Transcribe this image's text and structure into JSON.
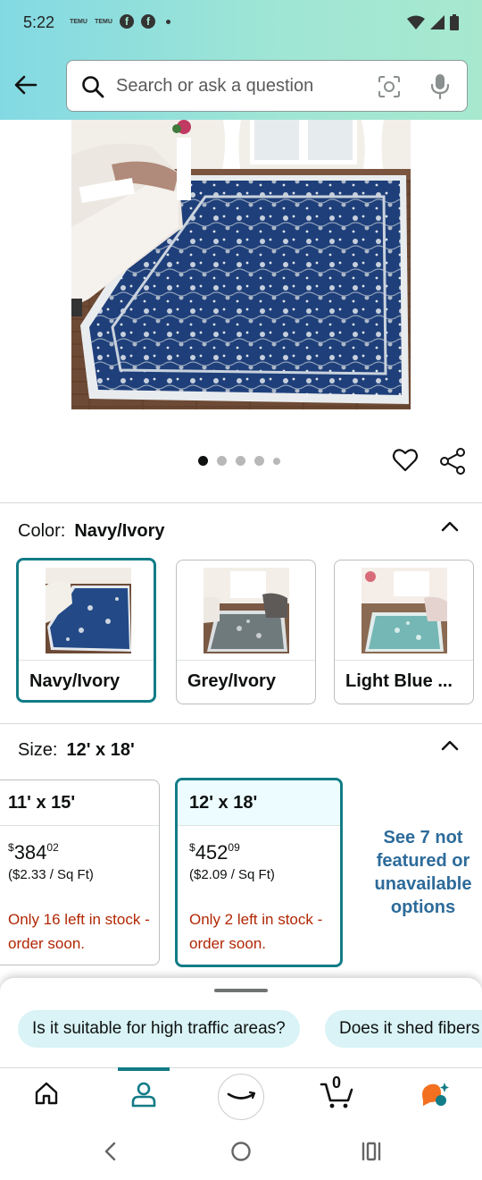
{
  "status_bar": {
    "time": "5:22",
    "badges": [
      "TEMU",
      "TEMU"
    ]
  },
  "search": {
    "placeholder": "Search or ask a question"
  },
  "gallery": {
    "image_count": 5,
    "active_index": 0
  },
  "color_section": {
    "label": "Color:",
    "selected": "Navy/Ivory",
    "options": [
      {
        "label": "Navy/Ivory",
        "selected": true
      },
      {
        "label": "Grey/Ivory",
        "selected": false
      },
      {
        "label": "Light Blue ...",
        "selected": false
      }
    ]
  },
  "size_section": {
    "label": "Size:",
    "selected": "12' x 18'",
    "options": [
      {
        "size": "11' x 15'",
        "price_dollar": "$",
        "price_whole": "384",
        "price_cents": "02",
        "unit_price": "($2.33 / Sq Ft)",
        "stock": "Only 16 left in stock - order soon.",
        "selected": false
      },
      {
        "size": "12' x 18'",
        "price_dollar": "$",
        "price_whole": "452",
        "price_cents": "09",
        "unit_price": "($2.09 / Sq Ft)",
        "stock": "Only 2 left in stock - order soon.",
        "selected": true
      }
    ],
    "see_more": "See 7 not featured or unavailable options"
  },
  "questions": {
    "chips": [
      "Is it suitable for high traffic areas?",
      "Does it shed fibers"
    ]
  },
  "bottom_nav": {
    "cart_count": "0",
    "active": "account"
  },
  "colors": {
    "accent": "#127c87",
    "link": "#2d6b9a",
    "stock_warning": "#b12704",
    "chip_bg": "#d9f3f6"
  }
}
